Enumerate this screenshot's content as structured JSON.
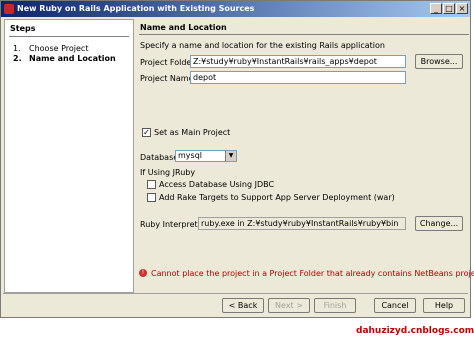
{
  "window": {
    "title": "New Ruby on Rails Application with Existing Sources"
  },
  "steps": {
    "header": "Steps",
    "items": [
      {
        "num": "1.",
        "label": "Choose Project"
      },
      {
        "num": "2.",
        "label": "Name and Location"
      }
    ]
  },
  "main": {
    "header": "Name and Location",
    "description": "Specify a name and location for the existing Rails application",
    "project_folder": {
      "label": "Project Folder:",
      "value": "Z:¥study¥ruby¥InstantRails¥rails_apps¥depot",
      "button": "Browse..."
    },
    "project_name": {
      "label": "Project Name:",
      "value": "depot"
    },
    "set_main_project": {
      "label": "Set as Main Project",
      "checked": true
    },
    "database": {
      "label": "Database:",
      "value": "mysql"
    },
    "if_using_jruby": "If Using JRuby",
    "access_jdbc": {
      "label": "Access Database Using JDBC",
      "checked": false
    },
    "rake_targets": {
      "label": "Add Rake Targets to Support App Server Deployment (war)",
      "checked": false
    },
    "ruby_interpreter": {
      "label": "Ruby Interpreter:",
      "value": "ruby.exe in Z:¥study¥ruby¥InstantRails¥ruby¥bin",
      "button": "Change..."
    },
    "error": "Cannot place the project in a Project Folder that already contains NetBeans project."
  },
  "buttons": {
    "back": "< Back",
    "next": "Next >",
    "finish": "Finish",
    "cancel": "Cancel",
    "help": "Help"
  },
  "watermark": "dahuzizyd.cnblogs.com"
}
